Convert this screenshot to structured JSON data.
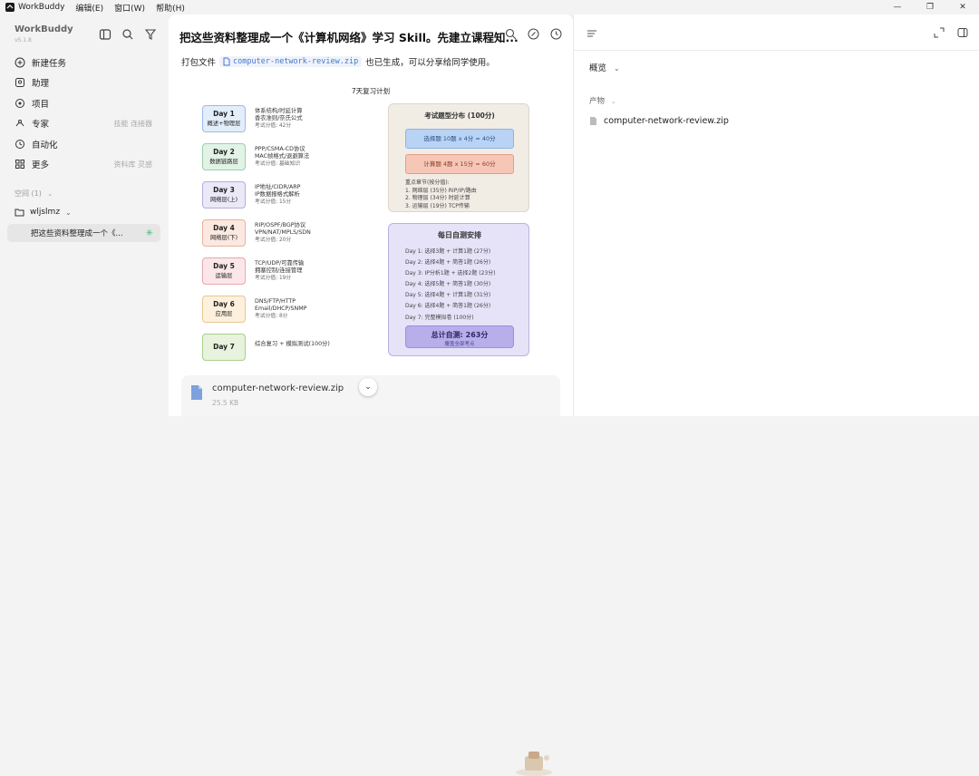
{
  "menubar": {
    "app_name": "WorkBuddy",
    "items": [
      "编辑(E)",
      "窗口(W)",
      "帮助(H)"
    ],
    "win_controls": [
      "—",
      "❐",
      "✕"
    ]
  },
  "sidebar": {
    "brand": "WorkBuddy",
    "version": "v5.1.8",
    "nav": [
      {
        "label": "新建任务",
        "hint": "",
        "icon": "plus-circle-icon"
      },
      {
        "label": "助理",
        "hint": "",
        "icon": "assistant-icon"
      },
      {
        "label": "项目",
        "hint": "",
        "icon": "project-icon"
      },
      {
        "label": "专家",
        "hint": "技能 连接器",
        "icon": "expert-icon"
      },
      {
        "label": "自动化",
        "hint": "",
        "icon": "clock-icon"
      },
      {
        "label": "更多",
        "hint": "资料库 灵感",
        "icon": "grid-icon"
      }
    ],
    "space_header": "空间 (1)",
    "folder": "wljslmz",
    "task": "把这些资料整理成一个《..."
  },
  "main": {
    "title": "把这些资料整理成一个《计算机网络》学习 Skill。先建立课程知...",
    "message_before": "打包文件",
    "file_link": "computer-network-review.zip",
    "message_after": "也已生成，可以分享给同学使用。",
    "plan": {
      "title": "7天复习计划",
      "days": [
        {
          "name": "Day 1",
          "sub": "概述+物理层",
          "l1": "体系结构/时延计算",
          "l2": "香农准则/奈氏公式",
          "l3": "考试分值: 42分"
        },
        {
          "name": "Day 2",
          "sub": "数据链路层",
          "l1": "PPP/CSMA-CD协议",
          "l2": "MAC帧格式/退避算法",
          "l3": "考试分值: 基础知识"
        },
        {
          "name": "Day 3",
          "sub": "网络层(上)",
          "l1": "IP地址/CIDR/ARP",
          "l2": "IP数据报格式解析",
          "l3": "考试分值: 15分"
        },
        {
          "name": "Day 4",
          "sub": "网络层(下)",
          "l1": "RIP/OSPF/BGP协议",
          "l2": "VPN/NAT/MPLS/SDN",
          "l3": "考试分值: 20分"
        },
        {
          "name": "Day 5",
          "sub": "运输层",
          "l1": "TCP/UDP/可靠传输",
          "l2": "拥塞控制/连接管理",
          "l3": "考试分值: 19分"
        },
        {
          "name": "Day 6",
          "sub": "应用层",
          "l1": "DNS/FTP/HTTP",
          "l2": "Email/DHCP/SNMP",
          "l3": "考试分值: 8分"
        },
        {
          "name": "Day 7",
          "sub": "",
          "l1": "综合复习 + 模拟测试(100分)",
          "l2": "",
          "l3": ""
        }
      ],
      "exam": {
        "title": "考试题型分布 (100分)",
        "choice": "选择题 10题 x 4分 = 40分",
        "calc": "计算题 4题 x 15分 = 60分",
        "key_title": "重点章节(按分值):",
        "keys": [
          "1. 网络层 (35分) RIP/IP/路由",
          "2. 物理层 (34分) 时延计算",
          "3. 运输层 (19分) TCP传输"
        ]
      },
      "daily": {
        "title": "每日自测安排",
        "lines": [
          "Day 1: 选择3题 + 计算1题 (27分)",
          "Day 2: 选择4题 + 简答1题 (26分)",
          "Day 3: IP分析1题 + 选择2题 (23分)",
          "Day 4: 选择5题 + 简答1题 (30分)",
          "Day 5: 选择4题 + 计算1题 (31分)",
          "Day 6: 选择4题 + 简答1题 (26分)",
          "Day 7: 完整模拟卷 (100分)"
        ],
        "total": "总计自测: 263分",
        "total_sub": "覆盖全部考点"
      }
    },
    "card": {
      "filename": "computer-network-review.zip",
      "size": "25.5 KB"
    }
  },
  "right": {
    "overview": "概览",
    "products": "产物",
    "file": "computer-network-review.zip"
  },
  "colors": {
    "day1": "#e3eefb",
    "day1b": "#9dbbe5",
    "day2": "#e2f3e6",
    "day2b": "#9ccfa8",
    "day3": "#ebe8f8",
    "day3b": "#b5acdf",
    "day4": "#fbe9e1",
    "day4b": "#e6b39f",
    "day5": "#fbe6ea",
    "day5b": "#e7a7b3",
    "day6": "#fdf1de",
    "day6b": "#e8c68f",
    "day7": "#e7f3dd",
    "day7b": "#aacf8d"
  }
}
